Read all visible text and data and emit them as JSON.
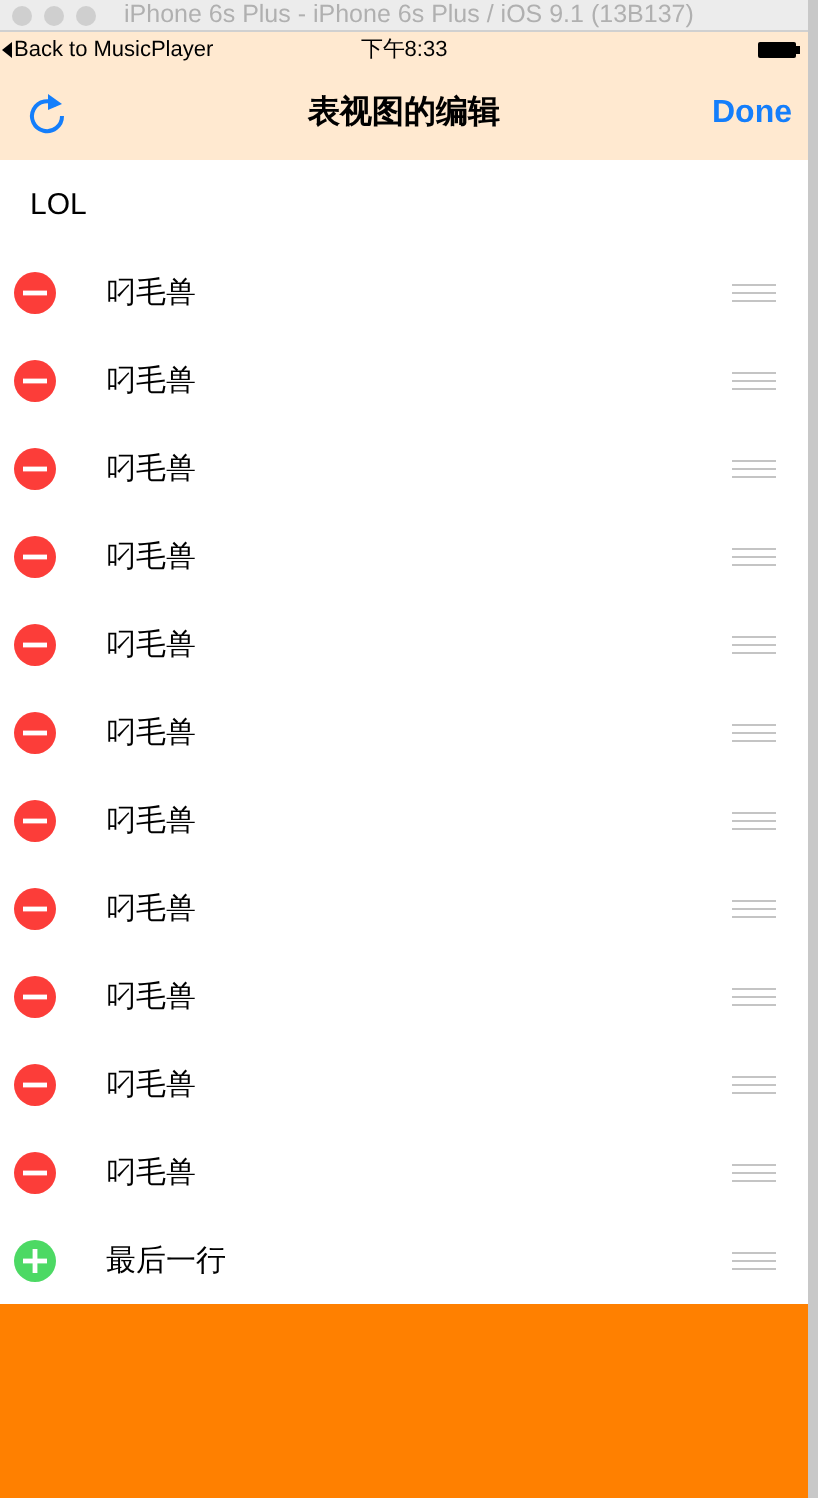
{
  "window": {
    "title": "iPhone 6s Plus - iPhone 6s Plus / iOS 9.1 (13B137)"
  },
  "status_bar": {
    "back": "Back to MusicPlayer",
    "time": "下午8:33"
  },
  "nav_bar": {
    "title": "表视图的编辑",
    "done": "Done"
  },
  "section_header": "LOL",
  "rows": [
    {
      "kind": "delete",
      "label": "叼毛兽"
    },
    {
      "kind": "delete",
      "label": "叼毛兽"
    },
    {
      "kind": "delete",
      "label": "叼毛兽"
    },
    {
      "kind": "delete",
      "label": "叼毛兽"
    },
    {
      "kind": "delete",
      "label": "叼毛兽"
    },
    {
      "kind": "delete",
      "label": "叼毛兽"
    },
    {
      "kind": "delete",
      "label": "叼毛兽"
    },
    {
      "kind": "delete",
      "label": "叼毛兽"
    },
    {
      "kind": "delete",
      "label": "叼毛兽"
    },
    {
      "kind": "delete",
      "label": "叼毛兽"
    },
    {
      "kind": "delete",
      "label": "叼毛兽"
    },
    {
      "kind": "insert",
      "label": "最后一行"
    }
  ]
}
